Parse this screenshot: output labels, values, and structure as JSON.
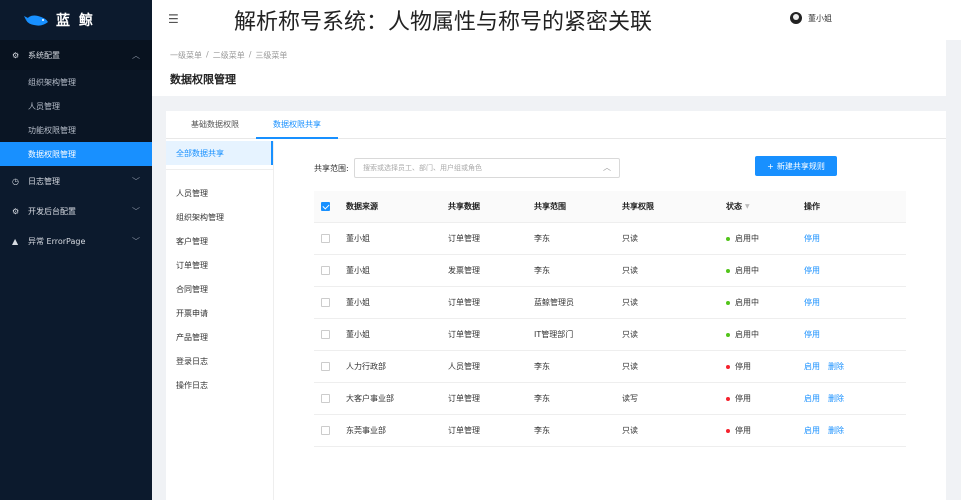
{
  "app": {
    "logo_text": "蓝 鲸"
  },
  "overlay_title": "解析称号系统：人物属性与称号的紧密关联",
  "user": {
    "name": "董小姐"
  },
  "sidebar": {
    "groups": [
      {
        "label": "系统配置",
        "icon": "gear-icon",
        "open": true,
        "items": [
          {
            "label": "组织架构管理",
            "active": false
          },
          {
            "label": "人员管理",
            "active": false
          },
          {
            "label": "功能权限管理",
            "active": false
          },
          {
            "label": "数据权限管理",
            "active": true
          }
        ]
      },
      {
        "label": "日志管理",
        "icon": "clock-icon",
        "open": false
      },
      {
        "label": "开发后台配置",
        "icon": "settings-icon",
        "open": false
      },
      {
        "label": "异常 ErrorPage",
        "icon": "warning-icon",
        "open": false
      }
    ]
  },
  "breadcrumb": [
    "一级菜单",
    "/",
    "二级菜单",
    "/",
    "三级菜单"
  ],
  "page_title": "数据权限管理",
  "tabs": [
    {
      "label": "基础数据权限",
      "active": false
    },
    {
      "label": "数据权限共享",
      "active": true
    }
  ],
  "leftnav": {
    "top": "全部数据共享",
    "items": [
      "人员管理",
      "组织架构管理",
      "客户管理",
      "订单管理",
      "合同管理",
      "开票申请",
      "产品管理",
      "登录日志",
      "操作日志"
    ]
  },
  "filter": {
    "label": "共享范围:",
    "placeholder": "搜索或选择员工、部门、用户组或角色"
  },
  "new_button": {
    "icon": "+",
    "label": "新建共享规则"
  },
  "table": {
    "headers": [
      "数据来源",
      "共享数据",
      "共享范围",
      "共享权限",
      "状态",
      "操作"
    ],
    "rows": [
      {
        "source": "董小姐",
        "data": "订单管理",
        "scope": "李东",
        "perm": "只读",
        "status": "启用中",
        "status_color": "#52c41a",
        "actions": [
          "停用"
        ]
      },
      {
        "source": "董小姐",
        "data": "发票管理",
        "scope": "李东",
        "perm": "只读",
        "status": "启用中",
        "status_color": "#52c41a",
        "actions": [
          "停用"
        ]
      },
      {
        "source": "董小姐",
        "data": "订单管理",
        "scope": "蓝鲸管理员",
        "perm": "只读",
        "status": "启用中",
        "status_color": "#52c41a",
        "actions": [
          "停用"
        ]
      },
      {
        "source": "董小姐",
        "data": "订单管理",
        "scope": "IT管理部门",
        "perm": "只读",
        "status": "启用中",
        "status_color": "#52c41a",
        "actions": [
          "停用"
        ]
      },
      {
        "source": "人力行政部",
        "data": "人员管理",
        "scope": "李东",
        "perm": "只读",
        "status": "停用",
        "status_color": "#f5222d",
        "actions": [
          "启用",
          "删除"
        ]
      },
      {
        "source": "大客户事业部",
        "data": "订单管理",
        "scope": "李东",
        "perm": "读写",
        "status": "停用",
        "status_color": "#f5222d",
        "actions": [
          "启用",
          "删除"
        ]
      },
      {
        "source": "东莞事业部",
        "data": "订单管理",
        "scope": "李东",
        "perm": "只读",
        "status": "停用",
        "status_color": "#f5222d",
        "actions": [
          "启用",
          "删除"
        ]
      }
    ]
  }
}
